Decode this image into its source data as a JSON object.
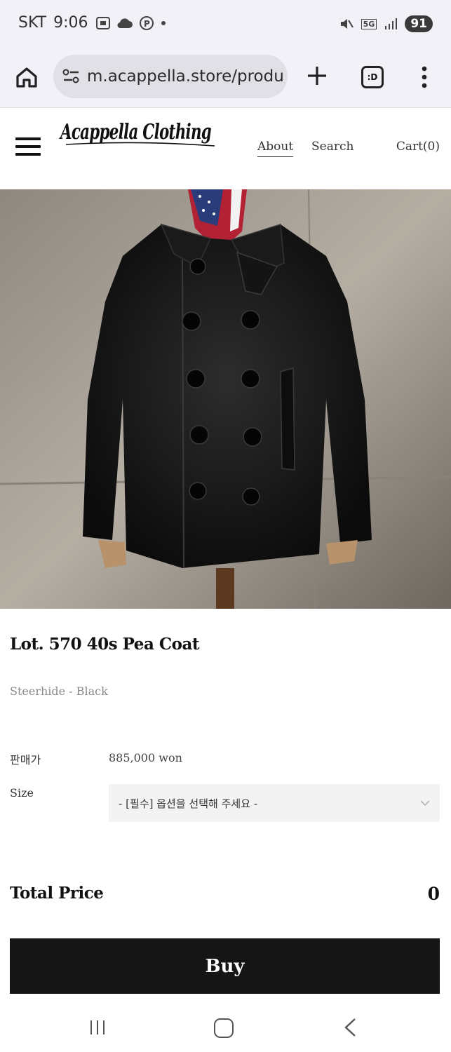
{
  "status_bar": {
    "carrier": "SKT",
    "time": "9:06",
    "network": "5G",
    "battery": "91"
  },
  "browser": {
    "url": "m.acappella.store/produ",
    "tabs_label": ":D"
  },
  "site": {
    "logo_text": "Acappella Clothing",
    "nav": {
      "about": "About",
      "search": "Search",
      "cart": "Cart(0)"
    }
  },
  "product": {
    "title": "Lot. 570 40s Pea Coat",
    "subtitle": "Steerhide - Black",
    "price_label": "판매가",
    "price_value": "885,000 won",
    "size_label": "Size",
    "size_placeholder": "- [필수] 옵션을 선택해 주세요 -",
    "total_label": "Total Price",
    "total_value": "0",
    "buy_label": "Buy"
  },
  "colors": {
    "status_bg": "#f2f1f8",
    "url_pill": "#e0e0e6",
    "buy_button": "#151515",
    "select_bg": "#f3f3f3"
  }
}
